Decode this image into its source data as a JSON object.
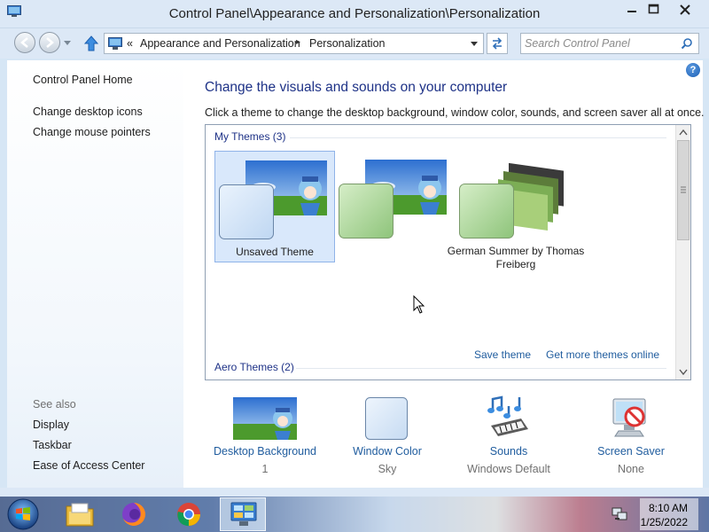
{
  "window": {
    "title": "Control Panel\\Appearance and Personalization\\Personalization",
    "controls": {
      "minimize": "minimize-icon",
      "maximize": "maximize-icon",
      "close": "close-icon"
    }
  },
  "navigation": {
    "breadcrumb_overflow": "«",
    "breadcrumbs": [
      "Appearance and Personalization",
      "Personalization"
    ],
    "separator": "▸",
    "search_placeholder": "Search Control Panel"
  },
  "sidebar": {
    "home": "Control Panel Home",
    "links": [
      "Change desktop icons",
      "Change mouse pointers"
    ],
    "see_also_heading": "See also",
    "see_also": [
      "Display",
      "Taskbar",
      "Ease of Access Center"
    ]
  },
  "main": {
    "heading": "Change the visuals and sounds on your computer",
    "description": "Click a theme to change the desktop background, window color, sounds, and screen saver all at once.",
    "help_icon": "?",
    "my_themes": {
      "header": "My Themes (3)",
      "items": [
        {
          "label": "Unsaved Theme",
          "selected": true
        },
        {
          "label": "",
          "selected": false
        },
        {
          "label": "German Summer by Thomas Freiberg",
          "selected": false
        }
      ]
    },
    "save_theme": "Save theme",
    "get_more_themes": "Get more themes online",
    "aero_themes": {
      "header": "Aero Themes (2)"
    }
  },
  "customizations": [
    {
      "name": "Desktop Background",
      "value": "1",
      "icon": "desktop-background-thumbnail"
    },
    {
      "name": "Window Color",
      "value": "Sky",
      "icon": "window-color-swatch"
    },
    {
      "name": "Sounds",
      "value": "Windows Default",
      "icon": "sounds-icon"
    },
    {
      "name": "Screen Saver",
      "value": "None",
      "icon": "screen-saver-icon"
    }
  ],
  "taskbar": {
    "start": "start-orb-icon",
    "apps": [
      "file-explorer-icon",
      "firefox-icon",
      "chrome-icon",
      "control-panel-icon"
    ],
    "time": "8:10 AM",
    "date": "1/25/2022"
  },
  "colors": {
    "heading": "#1e3287",
    "link": "#1f5c9e",
    "selection": "#d9e8fb"
  }
}
